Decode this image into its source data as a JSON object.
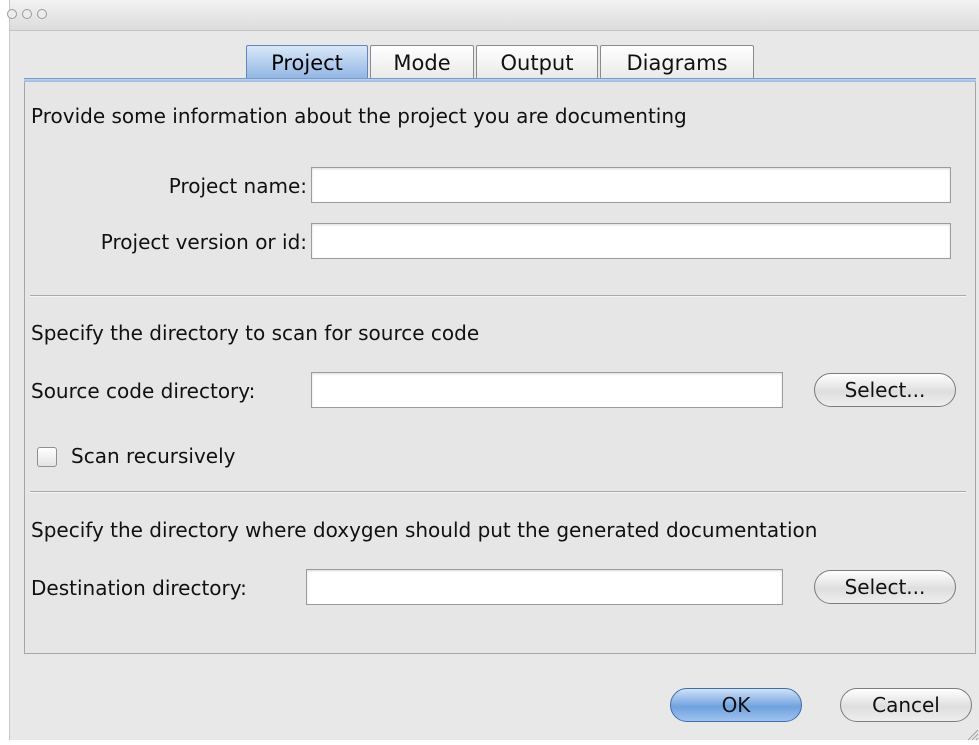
{
  "tabs": [
    {
      "label": "Project",
      "active": true
    },
    {
      "label": "Mode",
      "active": false
    },
    {
      "label": "Output",
      "active": false
    },
    {
      "label": "Diagrams",
      "active": false
    }
  ],
  "project_section": {
    "heading": "Provide some information about the project you are documenting",
    "name_label": "Project name:",
    "name_value": "",
    "version_label": "Project version or id:",
    "version_value": ""
  },
  "source_section": {
    "heading": "Specify the directory to scan for source code",
    "dir_label": "Source code directory:",
    "dir_value": "",
    "select_label": "Select...",
    "recursive_label": "Scan recursively",
    "recursive_checked": false
  },
  "destination_section": {
    "heading": "Specify the directory where doxygen should put the generated documentation",
    "dir_label": "Destination directory:",
    "dir_value": "",
    "select_label": "Select..."
  },
  "buttons": {
    "ok_label": "OK",
    "cancel_label": "Cancel"
  },
  "colors": {
    "accent": "#8fb5e3",
    "window_bg": "#e8e8e8"
  }
}
